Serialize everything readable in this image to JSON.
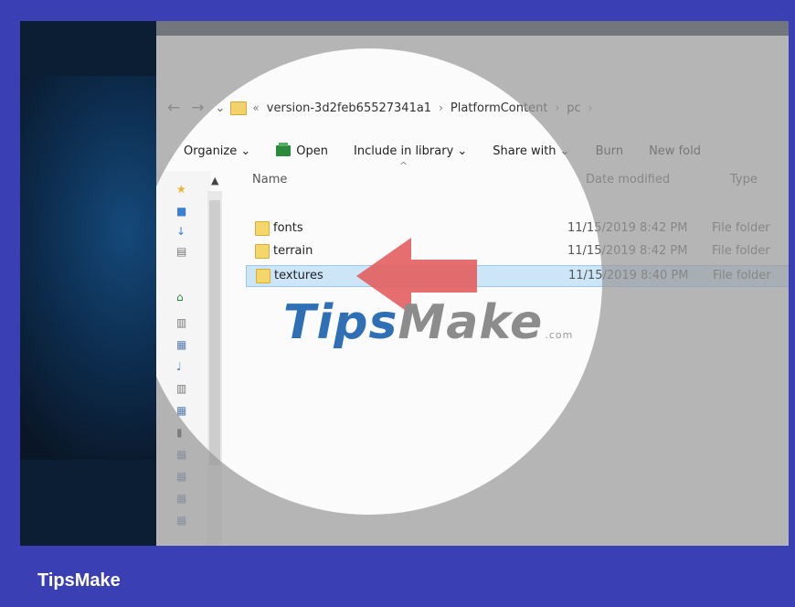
{
  "address_bar": {
    "back": "←",
    "forward": "→",
    "dropdown": "⌄",
    "overflow": "«",
    "crumbs": [
      "version-3d2feb65527341a1",
      "PlatformContent",
      "pc"
    ]
  },
  "toolbar": {
    "organize": "Organize ⌄",
    "open": "Open",
    "include": "Include in library ⌄",
    "share": "Share with ⌄",
    "burn": "Burn",
    "new_folder": "New fold"
  },
  "columns": {
    "name": "Name",
    "date": "Date modified",
    "type": "Type"
  },
  "files": [
    {
      "name": "fonts",
      "date": "11/15/2019 8:42 PM",
      "type": "File folder",
      "selected": false
    },
    {
      "name": "terrain",
      "date": "11/15/2019 8:42 PM",
      "type": "File folder",
      "selected": false
    },
    {
      "name": "textures",
      "date": "11/15/2019 8:40 PM",
      "type": "File folder",
      "selected": true
    }
  ],
  "watermark": {
    "t": "T",
    "ips": "ips",
    "make": "Make",
    "com": ".com"
  },
  "brand": "TipsMake",
  "colors": {
    "frame": "#3a3fb4",
    "selection": "#cde6f7",
    "arrow": "#e35e5e",
    "folder": "#f5d66b"
  }
}
